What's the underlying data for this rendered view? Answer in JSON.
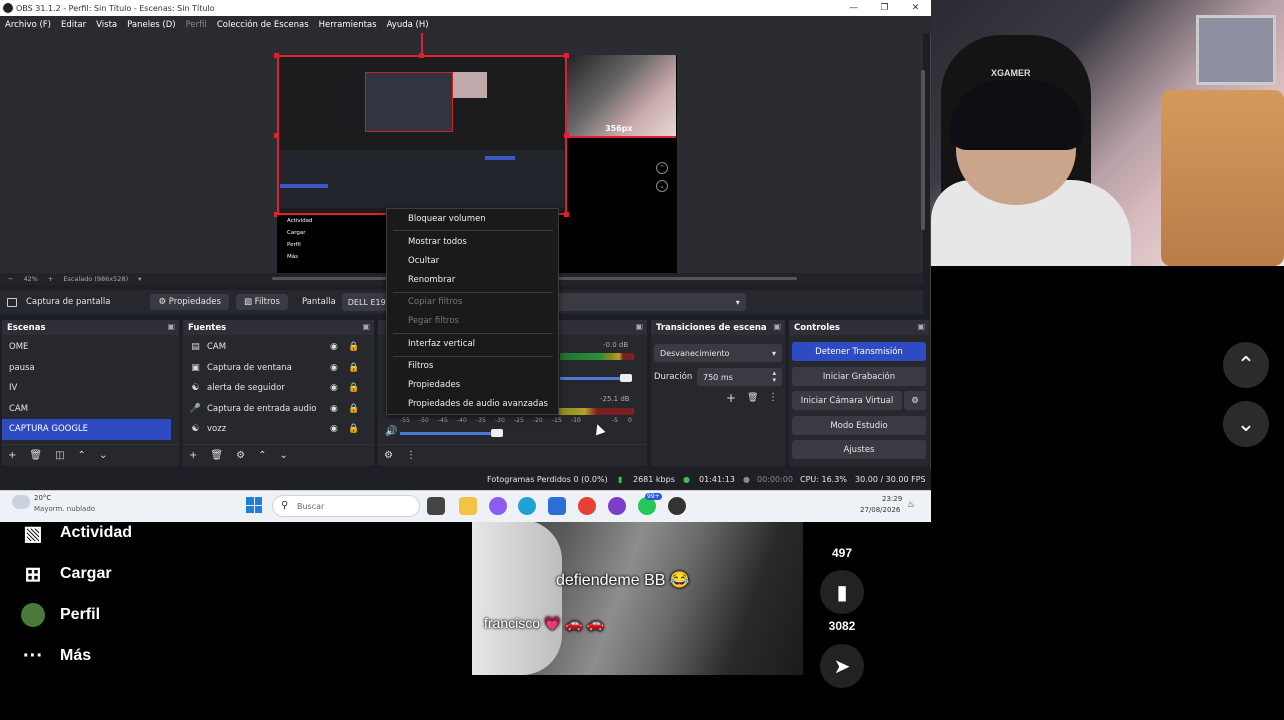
{
  "window": {
    "title": "OBS 31.1.2 - Perfil: Sin Título - Escenas: Sin Título"
  },
  "menubar": {
    "items": [
      "Archivo (F)",
      "Editar",
      "Vista",
      "Paneles (D)",
      "Perfil",
      "Colección de Escenas",
      "Herramientas",
      "Ayuda (H)"
    ]
  },
  "preview": {
    "zoom": "42%",
    "scale": "Escalado (986x528)",
    "cam_label": "356px",
    "nested_tt": [
      "Actividad",
      "Cargar",
      "Perfil",
      "Más"
    ]
  },
  "source_toolbar": {
    "source_name": "Captura de pantalla",
    "properties": "Propiedades",
    "filters": "Filtros",
    "display_label": "Pantalla",
    "display_value": "DELL E1912"
  },
  "scenes": {
    "title": "Escenas",
    "items": [
      "OME",
      "pausa",
      "IV",
      "CAM",
      "CAPTURA GOOGLE"
    ],
    "selected_index": 4
  },
  "sources": {
    "title": "Fuentes",
    "items": [
      {
        "name": "CAM",
        "icon": "camera-icon"
      },
      {
        "name": "Captura de ventana",
        "icon": "window-icon"
      },
      {
        "name": "alerta de seguidor",
        "icon": "globe-icon"
      },
      {
        "name": "Captura de entrada audio",
        "icon": "mic-icon"
      },
      {
        "name": "vozz",
        "icon": "globe-icon"
      }
    ]
  },
  "mixer": {
    "channel1_db": "-0.0 dB",
    "channel2_db": "-25.1 dB",
    "ticks": [
      "-55",
      "-50",
      "-45",
      "-40",
      "-35",
      "-30",
      "-25",
      "-20",
      "-15",
      "-10",
      "-5",
      "0"
    ]
  },
  "transitions": {
    "title": "Transiciones de escena",
    "selected": "Desvanecimiento",
    "duration_label": "Duración",
    "duration_value": "750 ms"
  },
  "controls": {
    "title": "Controles",
    "stop_stream": "Detener Transmisión",
    "start_recording": "Iniciar Grabación",
    "start_virtual_cam": "Iniciar Cámara Virtual",
    "studio_mode": "Modo Estudio",
    "settings": "Ajustes"
  },
  "context_menu": {
    "items": [
      {
        "label": "Bloquear volumen",
        "enabled": true
      },
      {
        "label": "Mostrar todos",
        "enabled": true
      },
      {
        "label": "Ocultar",
        "enabled": true
      },
      {
        "label": "Renombrar",
        "enabled": true
      },
      {
        "label": "Copiar filtros",
        "enabled": false
      },
      {
        "label": "Pegar filtros",
        "enabled": false
      },
      {
        "label": "Interfaz vertical",
        "enabled": true
      },
      {
        "label": "Filtros",
        "enabled": true
      },
      {
        "label": "Propiedades",
        "enabled": true
      },
      {
        "label": "Propiedades de audio avanzadas",
        "enabled": true
      }
    ]
  },
  "status": {
    "dropped": "Fotogramas Perdidos 0 (0.0%)",
    "bitrate": "2681 kbps",
    "stream_time": "01:41:13",
    "rec_time": "00:00:00",
    "cpu": "CPU: 16.3%",
    "fps": "30.00 / 30.00 FPS"
  },
  "taskbar": {
    "weather_temp": "20°C",
    "weather_desc": "Mayorm. nublado",
    "search_placeholder": "Buscar",
    "time": "23:29",
    "date": "27/08/2026",
    "badge": "99+"
  },
  "tiktok": {
    "nav": [
      {
        "label": "Actividad",
        "icon": "activity-icon"
      },
      {
        "label": "Cargar",
        "icon": "upload-icon"
      },
      {
        "label": "Perfil",
        "icon": "avatar-icon"
      },
      {
        "label": "Más",
        "icon": "more-icon"
      }
    ],
    "caption_main": "defiendeme BB 😂",
    "caption_user": "francisco 💗 🚗 🚗",
    "count_comments": "497",
    "count_saves": "3082"
  },
  "webcam": {
    "chair_brand": "XGAMER"
  }
}
